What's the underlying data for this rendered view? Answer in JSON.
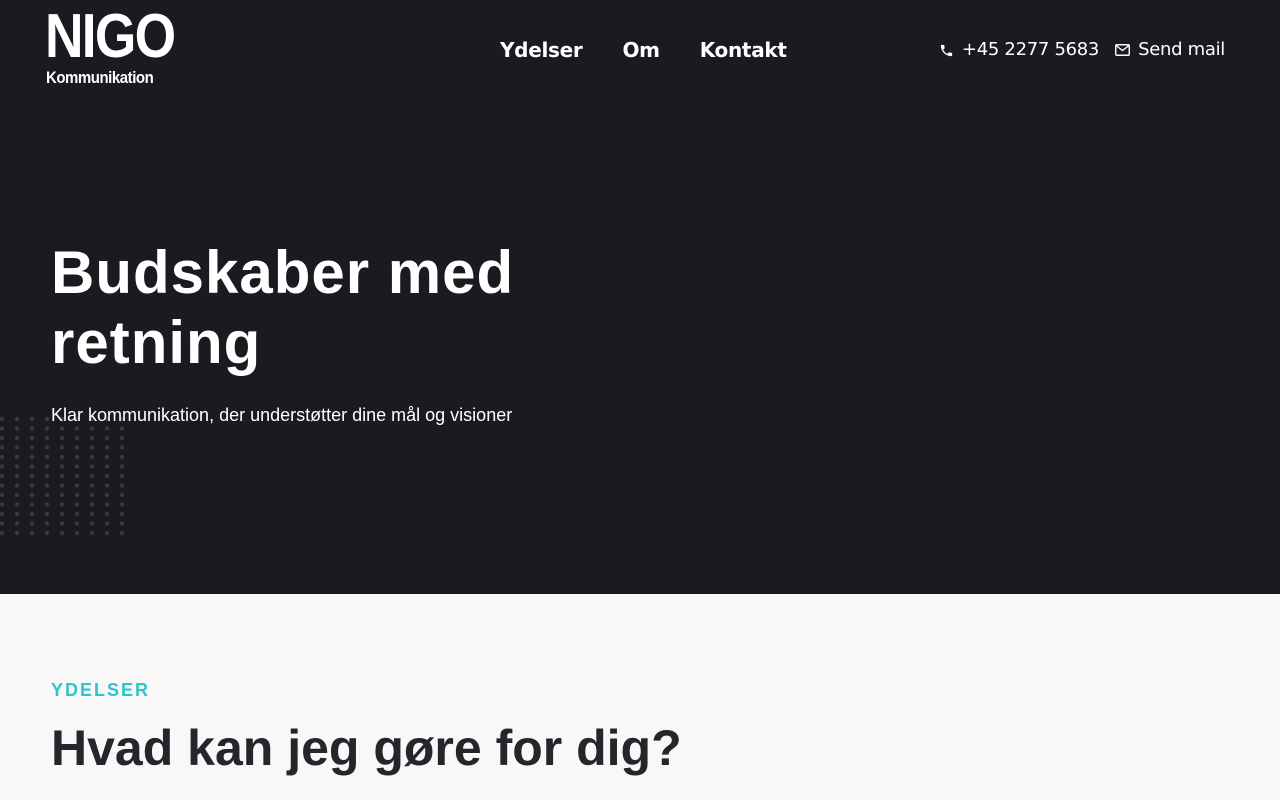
{
  "brand": {
    "logo_main": "NIGO",
    "logo_sub": "Kommunikation"
  },
  "nav": {
    "items": [
      {
        "label": "Ydelser"
      },
      {
        "label": "Om"
      },
      {
        "label": "Kontakt"
      }
    ]
  },
  "contact": {
    "phone": "+45 2277 5683",
    "phone_icon": "phone-icon",
    "mail": "Send mail",
    "mail_icon": "envelope-icon"
  },
  "hero": {
    "title": "Budskaber med retning",
    "subtitle": "Klar kommunikation, der understøtter dine mål og visioner"
  },
  "services": {
    "kicker": "YDELSER",
    "title": "Hvad kan jeg gøre for dig?"
  },
  "colors": {
    "hero_bg": "#1c1920",
    "accent": "#2ec4c9",
    "text_light": "#ffffff",
    "text_dark": "#26252b",
    "page_bg": "#f8f8f8"
  }
}
